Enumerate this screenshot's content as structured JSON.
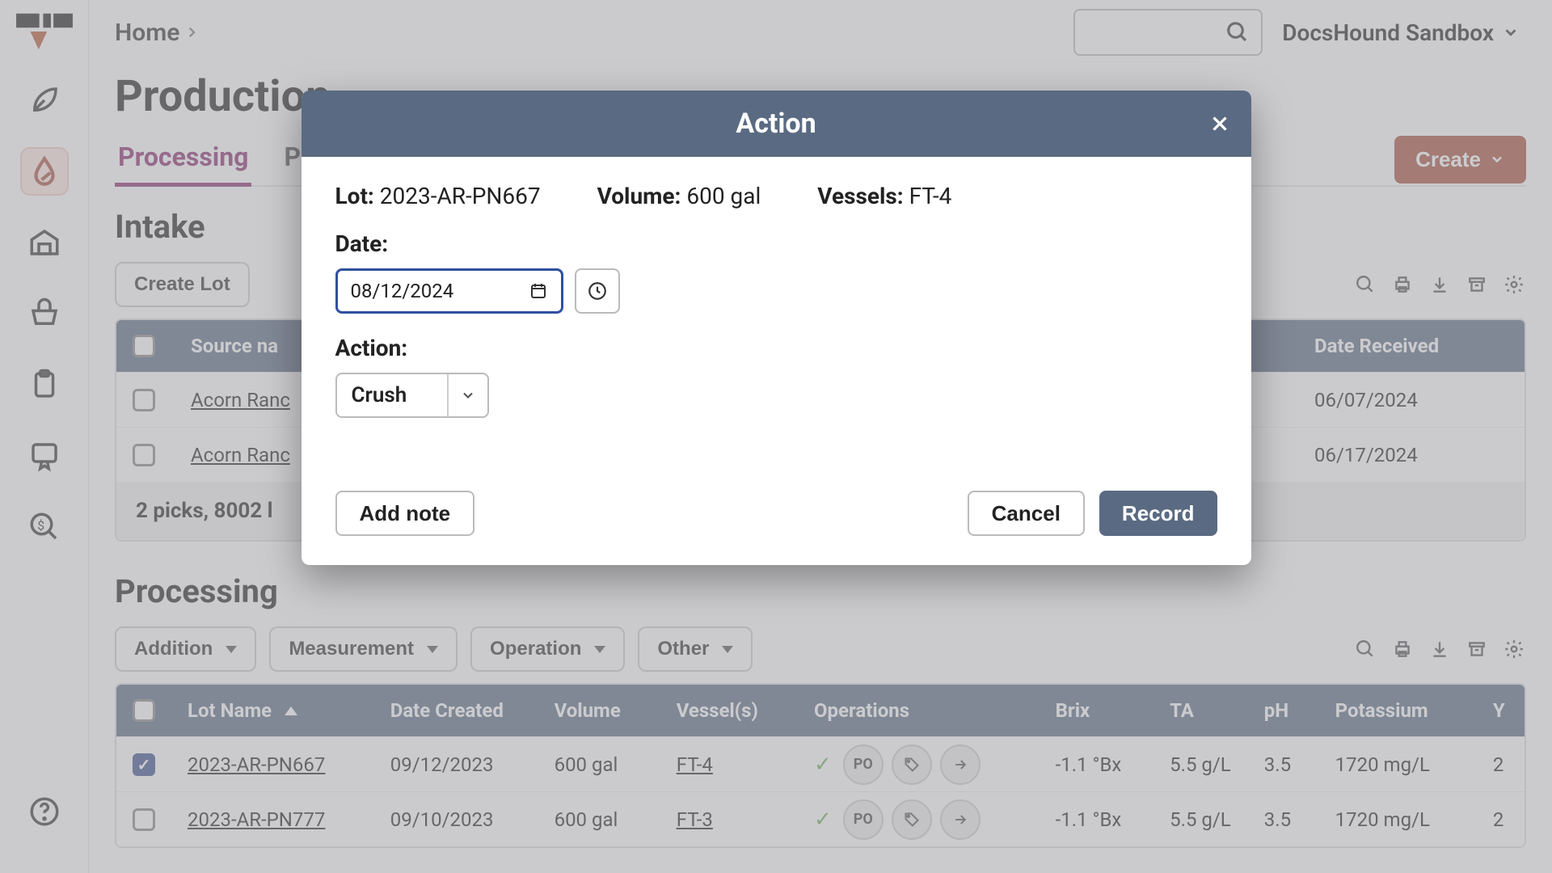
{
  "workspace": "DocsHound Sandbox",
  "breadcrumb": [
    "Home"
  ],
  "page_title": "Production",
  "tabs": [
    {
      "label": "Processing",
      "active": true
    },
    {
      "label": "P"
    }
  ],
  "create_button": "Create",
  "intake": {
    "heading": "Intake",
    "toolbar": {
      "create_lot": "Create Lot"
    },
    "columns": {
      "source": "Source na",
      "date_received": "Date Received"
    },
    "rows": [
      {
        "source": "Acorn Ranc",
        "date_received": "06/07/2024"
      },
      {
        "source": "Acorn Ranc",
        "date_received": "06/17/2024"
      }
    ],
    "footer": "2 picks, 8002 l"
  },
  "processing": {
    "heading": "Processing",
    "toolbar": {
      "addition": "Addition",
      "measurement": "Measurement",
      "operation": "Operation",
      "other": "Other"
    },
    "columns": {
      "lot": "Lot Name",
      "date_created": "Date Created",
      "volume": "Volume",
      "vessels": "Vessel(s)",
      "operations": "Operations",
      "brix": "Brix",
      "ta": "TA",
      "ph": "pH",
      "potassium": "Potassium",
      "extra": "Y"
    },
    "rows": [
      {
        "checked": true,
        "lot": "2023-AR-PN667",
        "date_created": "09/12/2023",
        "volume": "600 gal",
        "vessels": "FT-4",
        "op_badge": "PO",
        "brix": "-1.1 °Bx",
        "ta": "5.5 g/L",
        "ph": "3.5",
        "potassium": "1720 mg/L",
        "extra": "2"
      },
      {
        "checked": false,
        "lot": "2023-AR-PN777",
        "date_created": "09/10/2023",
        "volume": "600 gal",
        "vessels": "FT-3",
        "op_badge": "PO",
        "brix": "-1.1 °Bx",
        "ta": "5.5 g/L",
        "ph": "3.5",
        "potassium": "1720 mg/L",
        "extra": "2"
      }
    ]
  },
  "modal": {
    "title": "Action",
    "lot_label": "Lot:",
    "lot_value": "2023-AR-PN667",
    "volume_label": "Volume:",
    "volume_value": "600 gal",
    "vessels_label": "Vessels:",
    "vessels_value": "FT-4",
    "date_label": "Date:",
    "date_value": "08/12/2024",
    "action_label": "Action:",
    "action_value": "Crush",
    "add_note": "Add note",
    "cancel": "Cancel",
    "record": "Record"
  }
}
